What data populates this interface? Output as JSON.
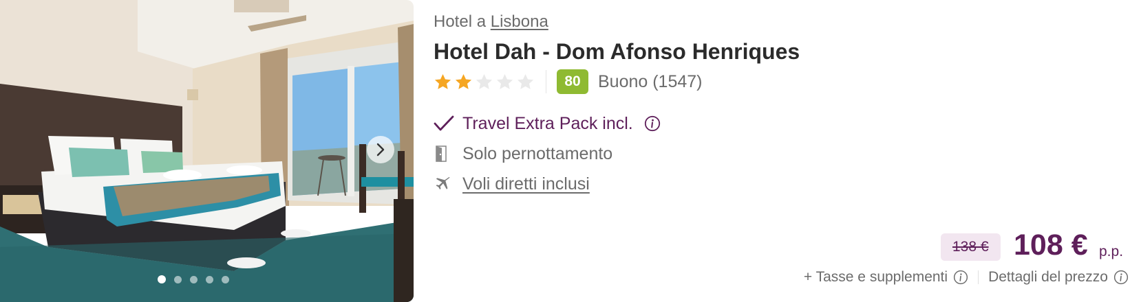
{
  "location": {
    "prefix": "Hotel a",
    "city": "Lisbona"
  },
  "hotel": {
    "name": "Hotel Dah - Dom Afonso Henriques",
    "stars": 2,
    "max_stars": 5
  },
  "rating": {
    "score": "80",
    "label": "Buono (1547)"
  },
  "features": {
    "extra_pack": {
      "label": "Travel Extra Pack incl.",
      "icon": "check-icon"
    },
    "board": {
      "label": "Solo pernottamento",
      "icon": "door-icon"
    },
    "flights": {
      "label": "Voli diretti inclusi",
      "icon": "plane-icon"
    }
  },
  "price": {
    "old": "138 €",
    "current": "108 €",
    "unit": "p.p.",
    "taxes_label": "+ Tasse e supplementi",
    "details_label": "Dettagli del prezzo"
  },
  "gallery": {
    "slide_count": 5,
    "active_slide": 1
  },
  "colors": {
    "brand": "#5e1f5a",
    "score_badge": "#8fba32",
    "star": "#f5a623",
    "muted_text": "#6b6b6b"
  }
}
